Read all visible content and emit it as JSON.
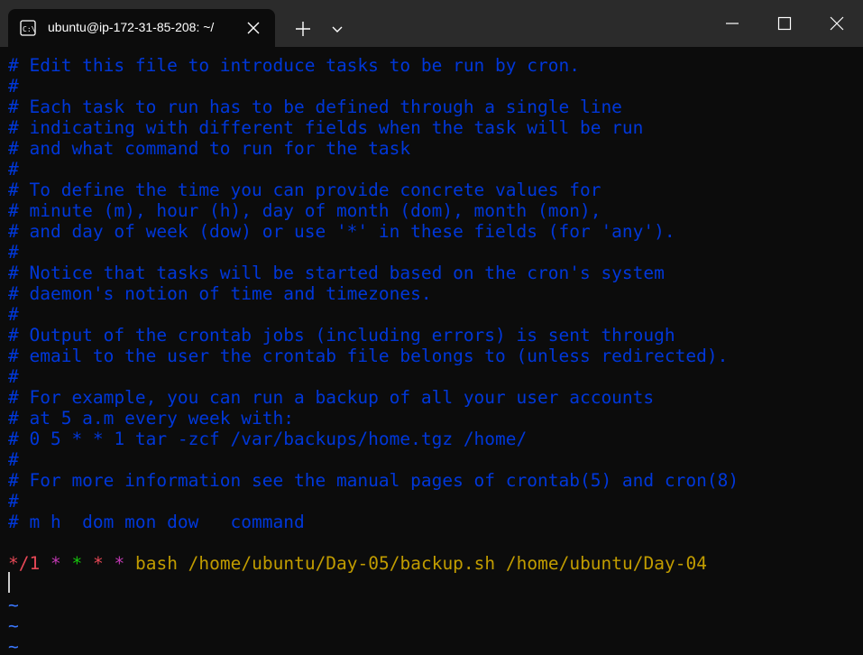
{
  "window": {
    "tab_title": "ubuntu@ip-172-31-85-208: ~/",
    "icons": {
      "tab": "terminal-icon",
      "close_tab": "close-icon",
      "new_tab": "plus-icon",
      "dropdown": "chevron-down-icon",
      "minimize": "minimize-icon",
      "maximize": "maximize-icon",
      "close_window": "close-icon"
    }
  },
  "colors": {
    "comment": "#0037da",
    "tilde": "#3b78ff",
    "background": "#0c0c0c",
    "titlebar": "#2b2b2b"
  },
  "editor": {
    "comment_lines": [
      "# Edit this file to introduce tasks to be run by cron.",
      "#",
      "# Each task to run has to be defined through a single line",
      "# indicating with different fields when the task will be run",
      "# and what command to run for the task",
      "#",
      "# To define the time you can provide concrete values for",
      "# minute (m), hour (h), day of month (dom), month (mon),",
      "# and day of week (dow) or use '*' in these fields (for 'any').",
      "#",
      "# Notice that tasks will be started based on the cron's system",
      "# daemon's notion of time and timezones.",
      "#",
      "# Output of the crontab jobs (including errors) is sent through",
      "# email to the user the crontab file belongs to (unless redirected).",
      "#",
      "# For example, you can run a backup of all your user accounts",
      "# at 5 a.m every week with:",
      "# 0 5 * * 1 tar -zcf /var/backups/home.tgz /home/",
      "#",
      "# For more information see the manual pages of crontab(5) and cron(8)",
      "#",
      "# m h  dom mon dow   command"
    ],
    "cron_entry": {
      "minute": "*/1",
      "hour": "*",
      "dom": "*",
      "mon": "*",
      "dow": "*",
      "command": "bash /home/ubuntu/Day-05/backup.sh /home/ubuntu/Day-04"
    },
    "empty_line_markers": [
      "~",
      "~",
      "~"
    ]
  }
}
